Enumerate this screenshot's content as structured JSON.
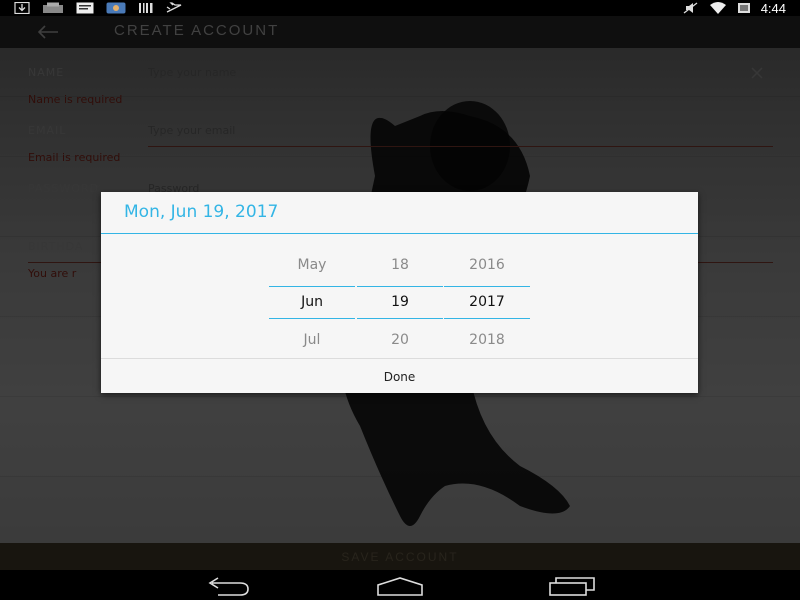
{
  "status_bar": {
    "time": "4:44",
    "left_icons": [
      "download-icon",
      "notification-icon",
      "message-icon",
      "app-icon",
      "barcode-icon",
      "flight-icon"
    ],
    "right_icons": [
      "mute-icon",
      "wifi-icon",
      "battery-icon"
    ]
  },
  "header": {
    "title": "CREATE ACCOUNT",
    "back_icon": "arrow-left-icon"
  },
  "form": {
    "name_label": "NAME",
    "name_placeholder": "Type your name",
    "name_error": "Name is required",
    "email_label": "EMAIL",
    "email_placeholder": "Type your email",
    "email_error": "Email is required",
    "password_label": "PASSWORD",
    "password_placeholder": "Password",
    "birthday_label": "BIRTHDA",
    "birthday_error": "You are r"
  },
  "save_button": "SAVE ACCOUNT",
  "date_picker": {
    "title": "Mon, Jun 19, 2017",
    "months": [
      "May",
      "Jun",
      "Jul"
    ],
    "days": [
      "18",
      "19",
      "20"
    ],
    "years": [
      "2016",
      "2017",
      "2018"
    ],
    "done_label": "Done"
  },
  "colors": {
    "accent": "#33b5e5",
    "error": "#5e1a12"
  },
  "nav_bar": {
    "icons": [
      "back-nav-icon",
      "home-nav-icon",
      "recents-nav-icon"
    ]
  }
}
